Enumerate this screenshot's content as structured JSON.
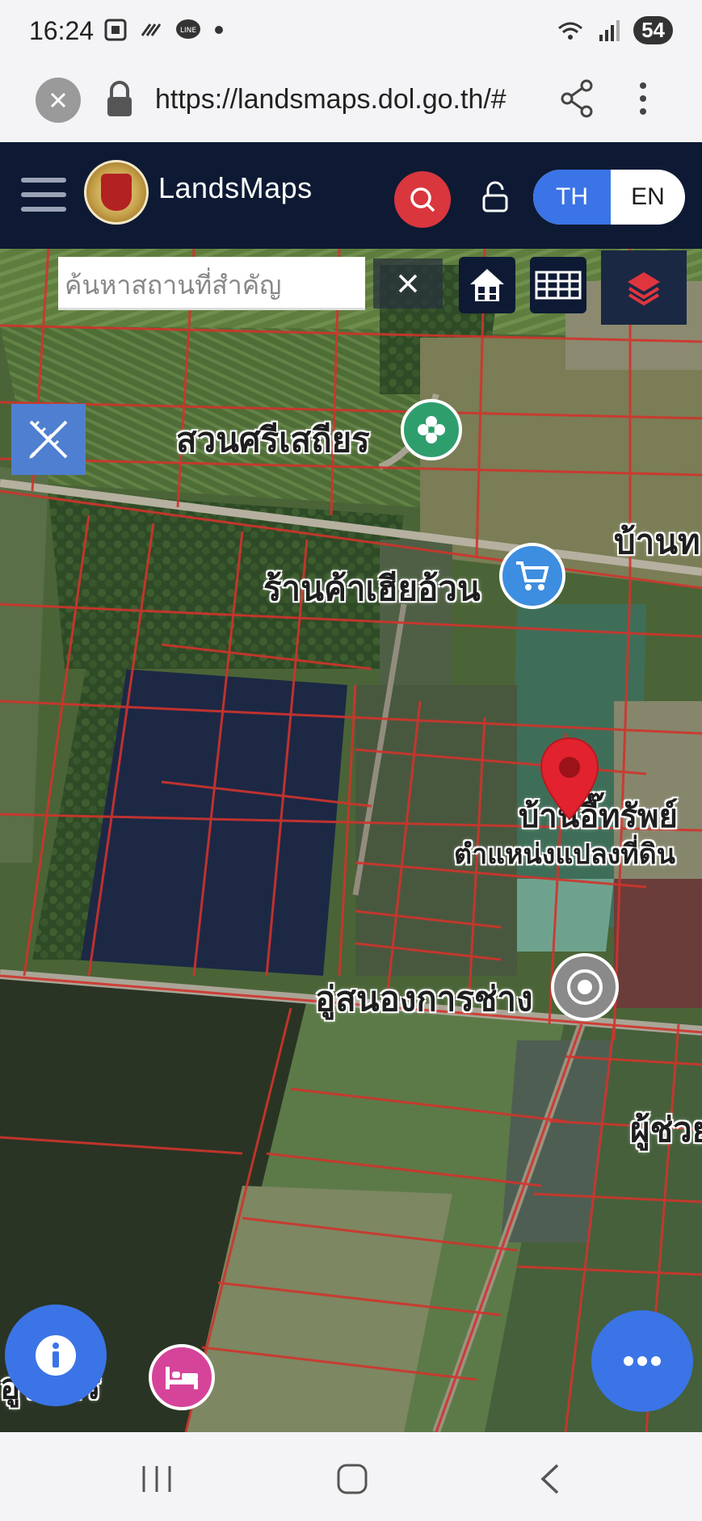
{
  "status_bar": {
    "time": "16:24",
    "battery": "54"
  },
  "browser": {
    "url": "https://landsmaps.dol.go.th/#"
  },
  "header": {
    "title": "LandsMaps",
    "lang_th": "TH",
    "lang_en": "EN"
  },
  "map": {
    "search_placeholder": "ค้นหาสถานที่สำคัญ",
    "poi": [
      {
        "label": "สวนศรีเสถียร"
      },
      {
        "label": "ร้านค้าเฮียอ้วน"
      },
      {
        "label": "บ้านท"
      },
      {
        "label": "บ้านอี๊ทรัพย์"
      },
      {
        "label": "ตำแหน่งแปลงที่ดิน"
      },
      {
        "label": "อู่สนองการช่าง"
      },
      {
        "label": "ผู้ช่วย"
      },
      {
        "label": "อู่ร่มศรี"
      }
    ]
  },
  "colors": {
    "header_bg": "#0e1a34",
    "accent_blue": "#3b74e6",
    "search_red": "#d9363e",
    "parcel_line": "#d0342c",
    "marker_red": "#e2222e"
  }
}
